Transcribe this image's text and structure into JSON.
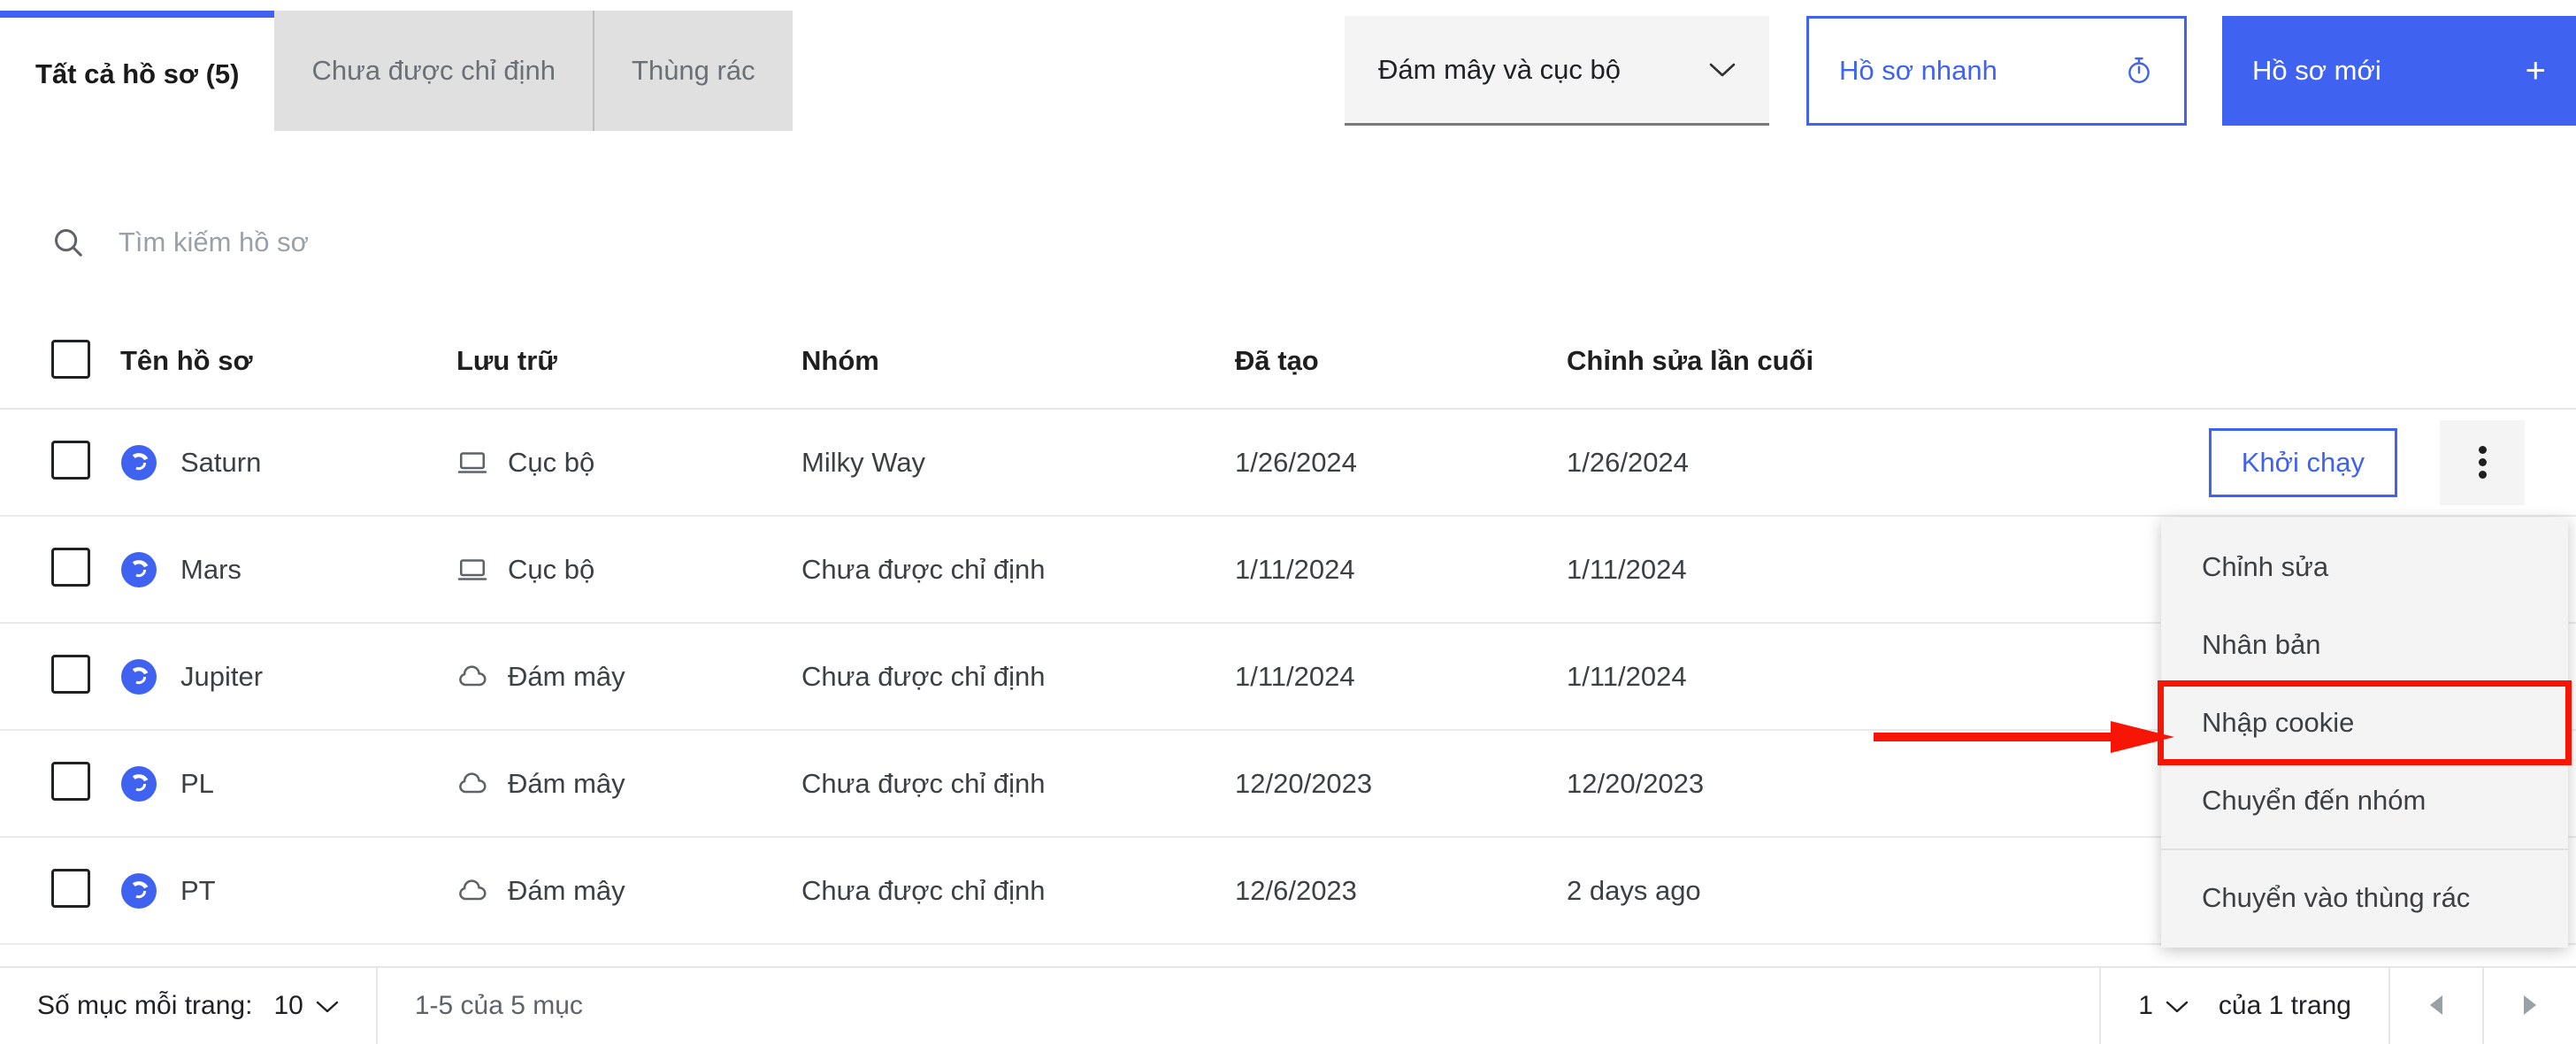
{
  "tabs": [
    {
      "label": "Tất cả hồ sơ (5)",
      "active": true
    },
    {
      "label": "Chưa được chỉ định",
      "active": false
    },
    {
      "label": "Thùng rác",
      "active": false
    }
  ],
  "toolbar": {
    "storage_filter_value": "Đám mây và cục bộ",
    "quick_profile_label": "Hồ sơ nhanh",
    "new_profile_label": "Hồ sơ mới",
    "plus_glyph": "+"
  },
  "search": {
    "placeholder": "Tìm kiếm hồ sơ",
    "value": ""
  },
  "table": {
    "headers": {
      "name": "Tên hồ sơ",
      "storage": "Lưu trữ",
      "group": "Nhóm",
      "created": "Đã tạo",
      "modified": "Chỉnh sửa lần cuối"
    },
    "launch_label": "Khởi chạy",
    "rows": [
      {
        "name": "Saturn",
        "storage": "Cục bộ",
        "storage_icon": "monitor-icon",
        "group": "Milky Way",
        "created": "1/26/2024",
        "modified": "1/26/2024"
      },
      {
        "name": "Mars",
        "storage": "Cục bộ",
        "storage_icon": "monitor-icon",
        "group": "Chưa được chỉ định",
        "created": "1/11/2024",
        "modified": "1/11/2024"
      },
      {
        "name": "Jupiter",
        "storage": "Đám mây",
        "storage_icon": "cloud-icon",
        "group": "Chưa được chỉ định",
        "created": "1/11/2024",
        "modified": "1/11/2024"
      },
      {
        "name": "PL",
        "storage": "Đám mây",
        "storage_icon": "cloud-icon",
        "group": "Chưa được chỉ định",
        "created": "12/20/2023",
        "modified": "12/20/2023"
      },
      {
        "name": "PT",
        "storage": "Đám mây",
        "storage_icon": "cloud-icon",
        "group": "Chưa được chỉ định",
        "created": "12/6/2023",
        "modified": "2 days ago"
      }
    ]
  },
  "context_menu": {
    "items": [
      {
        "label": "Chỉnh sửa",
        "highlighted": false
      },
      {
        "label": "Nhân bản",
        "highlighted": false
      },
      {
        "label": "Nhập cookie",
        "highlighted": true
      },
      {
        "label": "Chuyển đến nhóm",
        "highlighted": false
      }
    ],
    "destructive": {
      "label": "Chuyển vào thùng rác"
    }
  },
  "footer": {
    "per_page_label": "Số mục mỗi trang:",
    "per_page_value": "10",
    "range_label": "1-5 của 5 mục",
    "page_value": "1",
    "page_total_label": "của 1 trang"
  },
  "colors": {
    "accent_blue": "#3f63f0",
    "annotation_red": "#f71505",
    "tab_inactive_bg": "#e0e0e0",
    "menu_bg": "#f4f4f4"
  }
}
